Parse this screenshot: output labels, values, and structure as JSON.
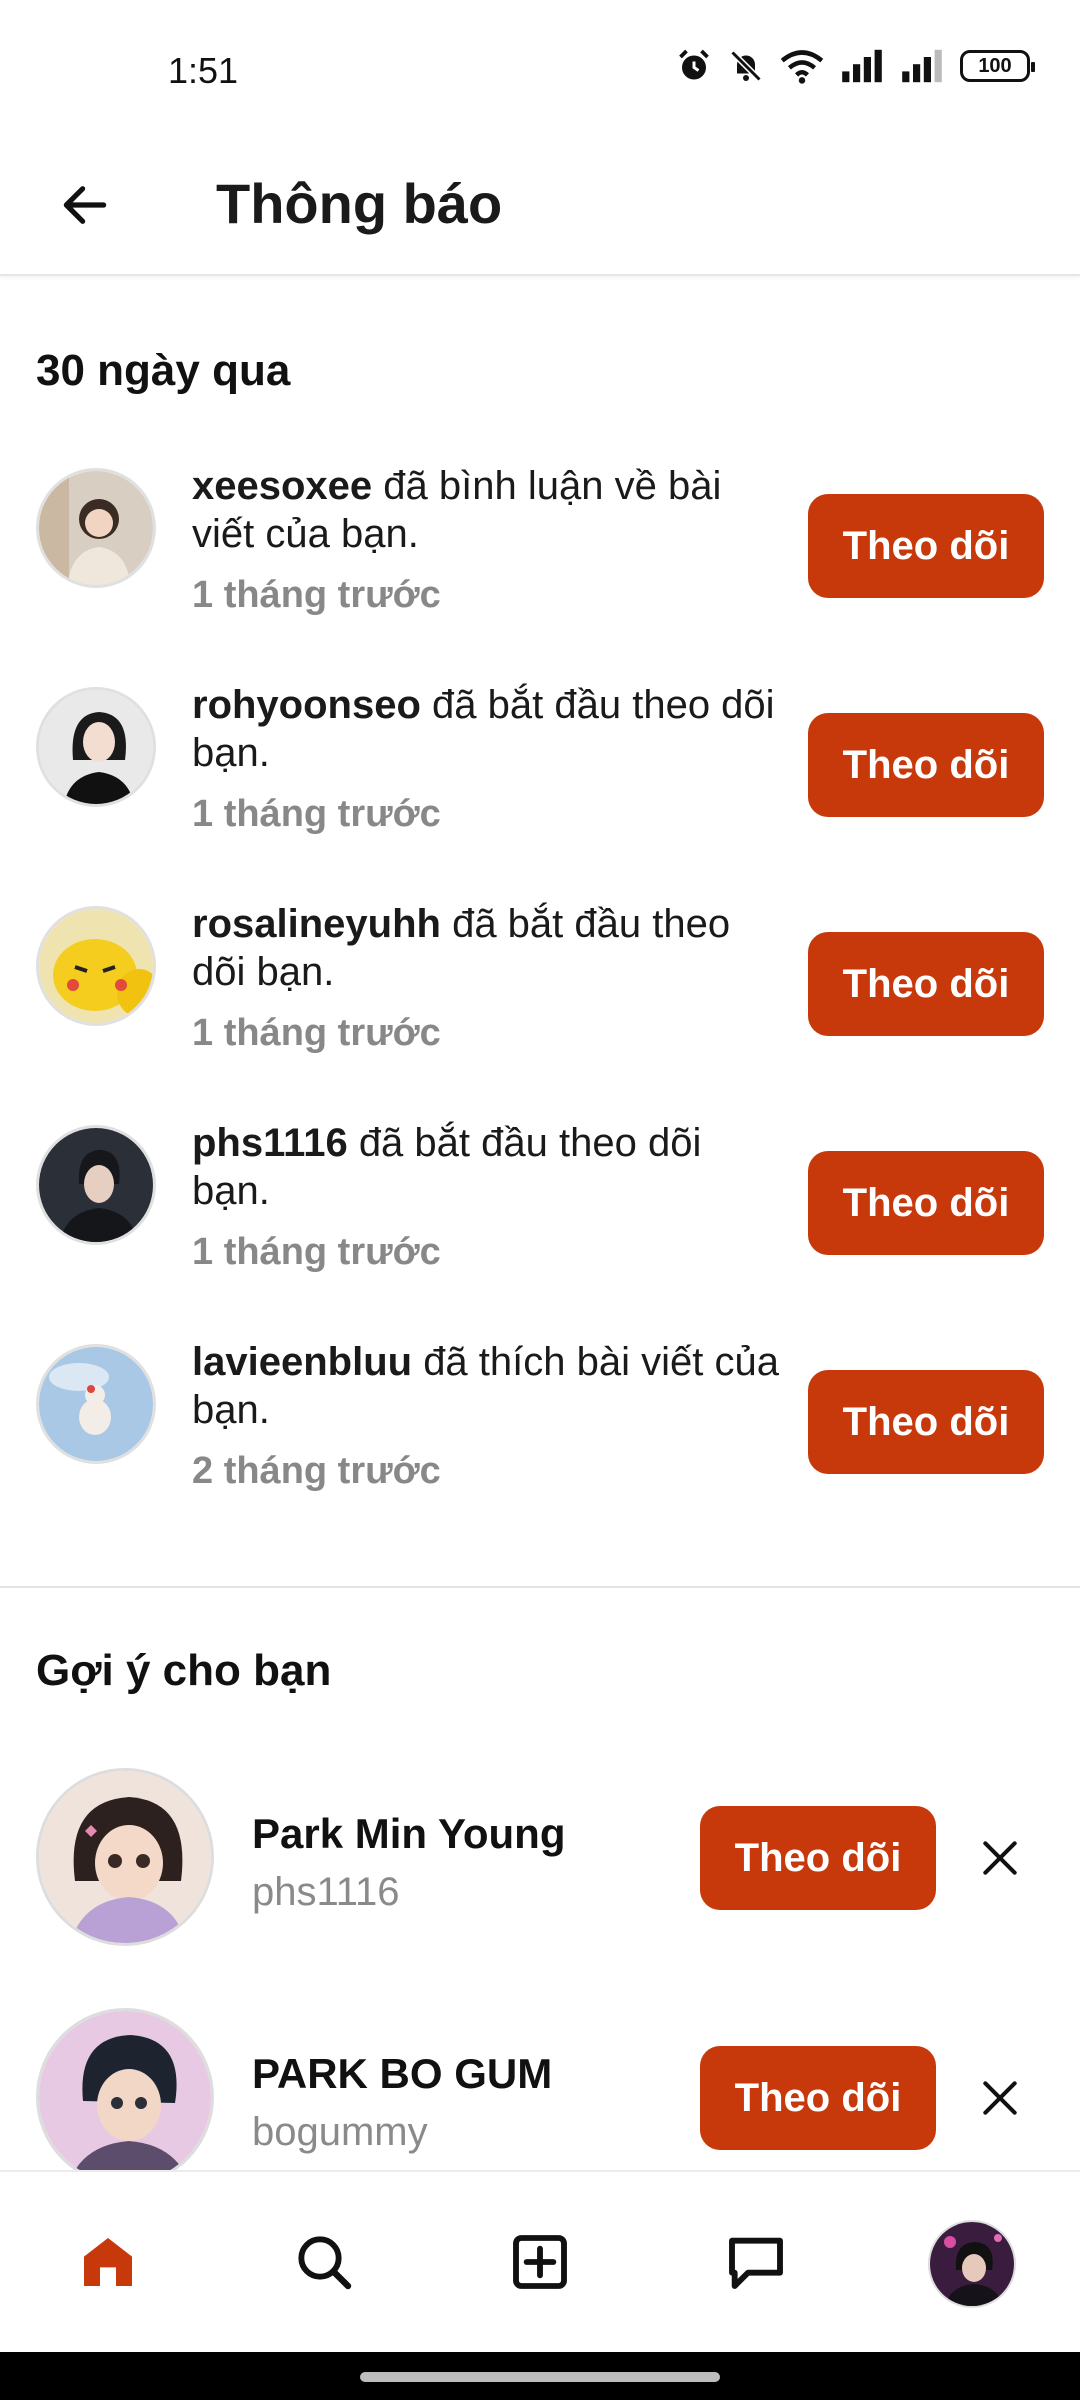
{
  "status_bar": {
    "time": "1:51",
    "battery": "100"
  },
  "header": {
    "title": "Thông báo"
  },
  "recent_section": {
    "title": "30 ngày qua"
  },
  "notifications": [
    {
      "username": "xeesoxee",
      "message": "đã bình luận về bài viết của bạn.",
      "time": "1 tháng trước",
      "button": "Theo dõi"
    },
    {
      "username": "rohyoonseo",
      "message": "đã bắt đầu theo dõi bạn.",
      "time": "1 tháng trước",
      "button": "Theo dõi"
    },
    {
      "username": "rosalineyuhh",
      "message": "đã bắt đầu theo dõi bạn.",
      "time": "1 tháng trước",
      "button": "Theo dõi"
    },
    {
      "username": "phs1116",
      "message": "đã bắt đầu theo dõi bạn.",
      "time": "1 tháng trước",
      "button": "Theo dõi"
    },
    {
      "username": "lavieenbluu",
      "message": "đã thích bài viết của bạn.",
      "time": "2 tháng trước",
      "button": "Theo dõi"
    }
  ],
  "suggest_section": {
    "title": "Gợi ý cho bạn"
  },
  "suggestions": [
    {
      "name": "Park Min Young",
      "handle": "phs1116",
      "button": "Theo dõi"
    },
    {
      "name": "PARK BO GUM",
      "handle": "bogummy",
      "button": "Theo dõi"
    }
  ],
  "nav": [
    "home-icon",
    "search-icon",
    "create-post-icon",
    "chat-icon",
    "profile-avatar"
  ],
  "colors": {
    "accent": "#c7380b",
    "muted_text": "#888888"
  }
}
